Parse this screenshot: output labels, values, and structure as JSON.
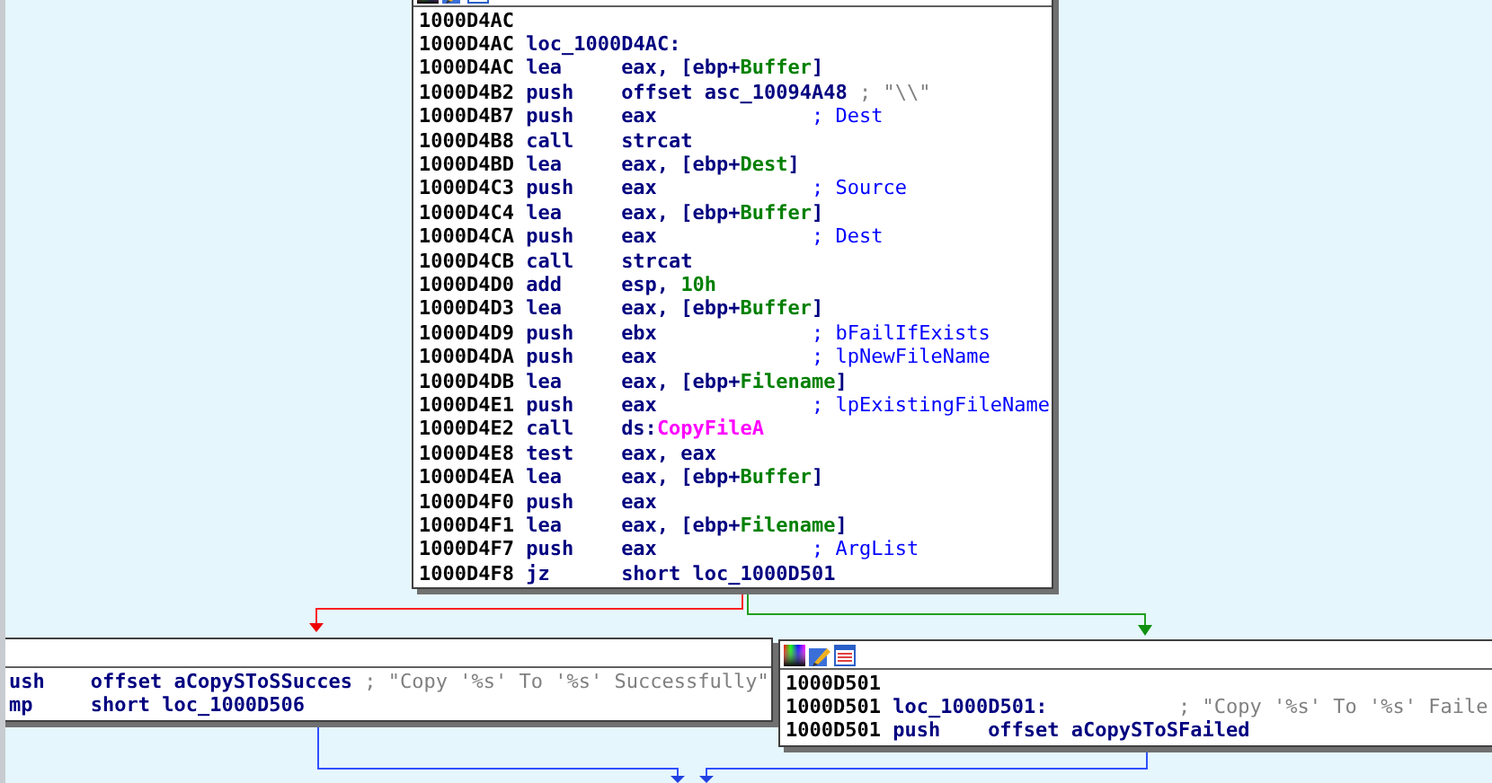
{
  "nodes": [
    {
      "icons": true,
      "lines": [
        {
          "address": "1000D4AC"
        },
        {
          "address": "1000D4AC",
          "label": "loc_1000D4AC:"
        },
        {
          "address": "1000D4AC",
          "mnemonic": "lea",
          "operand": [
            {
              "text": "eax, [ebp+",
              "kind": "plain"
            },
            {
              "text": "Buffer",
              "kind": "var"
            },
            {
              "text": "]",
              "kind": "plain"
            }
          ]
        },
        {
          "address": "1000D4B2",
          "mnemonic": "push",
          "operand": [
            {
              "text": "offset asc_10094A48",
              "kind": "plain"
            }
          ],
          "comment": {
            "text": "; \"\\\\\"",
            "kind": "string"
          }
        },
        {
          "address": "1000D4B7",
          "mnemonic": "push",
          "operand": [
            {
              "text": "eax",
              "kind": "plain"
            }
          ],
          "comment": {
            "text": "; Dest",
            "kind": "note"
          }
        },
        {
          "address": "1000D4B8",
          "mnemonic": "call",
          "operand": [
            {
              "text": "strcat",
              "kind": "plain"
            }
          ]
        },
        {
          "address": "1000D4BD",
          "mnemonic": "lea",
          "operand": [
            {
              "text": "eax, [ebp+",
              "kind": "plain"
            },
            {
              "text": "Dest",
              "kind": "var"
            },
            {
              "text": "]",
              "kind": "plain"
            }
          ]
        },
        {
          "address": "1000D4C3",
          "mnemonic": "push",
          "operand": [
            {
              "text": "eax",
              "kind": "plain"
            }
          ],
          "comment": {
            "text": "; Source",
            "kind": "note"
          }
        },
        {
          "address": "1000D4C4",
          "mnemonic": "lea",
          "operand": [
            {
              "text": "eax, [ebp+",
              "kind": "plain"
            },
            {
              "text": "Buffer",
              "kind": "var"
            },
            {
              "text": "]",
              "kind": "plain"
            }
          ]
        },
        {
          "address": "1000D4CA",
          "mnemonic": "push",
          "operand": [
            {
              "text": "eax",
              "kind": "plain"
            }
          ],
          "comment": {
            "text": "; Dest",
            "kind": "note"
          }
        },
        {
          "address": "1000D4CB",
          "mnemonic": "call",
          "operand": [
            {
              "text": "strcat",
              "kind": "plain"
            }
          ]
        },
        {
          "address": "1000D4D0",
          "mnemonic": "add",
          "operand": [
            {
              "text": "esp, ",
              "kind": "plain"
            },
            {
              "text": "10h",
              "kind": "number"
            }
          ]
        },
        {
          "address": "1000D4D3",
          "mnemonic": "lea",
          "operand": [
            {
              "text": "eax, [ebp+",
              "kind": "plain"
            },
            {
              "text": "Buffer",
              "kind": "var"
            },
            {
              "text": "]",
              "kind": "plain"
            }
          ]
        },
        {
          "address": "1000D4D9",
          "mnemonic": "push",
          "operand": [
            {
              "text": "ebx",
              "kind": "plain"
            }
          ],
          "comment": {
            "text": "; bFailIfExists",
            "kind": "note"
          }
        },
        {
          "address": "1000D4DA",
          "mnemonic": "push",
          "operand": [
            {
              "text": "eax",
              "kind": "plain"
            }
          ],
          "comment": {
            "text": "; lpNewFileName",
            "kind": "note"
          }
        },
        {
          "address": "1000D4DB",
          "mnemonic": "lea",
          "operand": [
            {
              "text": "eax, [ebp+",
              "kind": "plain"
            },
            {
              "text": "Filename",
              "kind": "var"
            },
            {
              "text": "]",
              "kind": "plain"
            }
          ]
        },
        {
          "address": "1000D4E1",
          "mnemonic": "push",
          "operand": [
            {
              "text": "eax",
              "kind": "plain"
            }
          ],
          "comment": {
            "text": "; lpExistingFileName",
            "kind": "note"
          }
        },
        {
          "address": "1000D4E2",
          "mnemonic": "call",
          "operand": [
            {
              "text": "ds:",
              "kind": "plain"
            },
            {
              "text": "CopyFileA",
              "kind": "import"
            }
          ]
        },
        {
          "address": "1000D4E8",
          "mnemonic": "test",
          "operand": [
            {
              "text": "eax, eax",
              "kind": "plain"
            }
          ]
        },
        {
          "address": "1000D4EA",
          "mnemonic": "lea",
          "operand": [
            {
              "text": "eax, [ebp+",
              "kind": "plain"
            },
            {
              "text": "Buffer",
              "kind": "var"
            },
            {
              "text": "]",
              "kind": "plain"
            }
          ]
        },
        {
          "address": "1000D4F0",
          "mnemonic": "push",
          "operand": [
            {
              "text": "eax",
              "kind": "plain"
            }
          ]
        },
        {
          "address": "1000D4F1",
          "mnemonic": "lea",
          "operand": [
            {
              "text": "eax, [ebp+",
              "kind": "plain"
            },
            {
              "text": "Filename",
              "kind": "var"
            },
            {
              "text": "]",
              "kind": "plain"
            }
          ]
        },
        {
          "address": "1000D4F7",
          "mnemonic": "push",
          "operand": [
            {
              "text": "eax",
              "kind": "plain"
            }
          ],
          "comment": {
            "text": "; ArgList",
            "kind": "note"
          }
        },
        {
          "address": "1000D4F8",
          "mnemonic": "jz",
          "operand": [
            {
              "text": "short loc_1000D501",
              "kind": "plain"
            }
          ]
        }
      ]
    },
    {
      "icons": false,
      "lines": [
        {
          "mnemonic": "ush",
          "operand": [
            {
              "text": "offset aCopySToSSucces",
              "kind": "plain"
            }
          ],
          "comment": {
            "text": "; \"Copy '%s' To '%s' Successfully\"",
            "kind": "string"
          }
        },
        {
          "mnemonic": "mp",
          "operand": [
            {
              "text": "short loc_1000D506",
              "kind": "plain"
            }
          ]
        }
      ]
    },
    {
      "icons": true,
      "lines": [
        {
          "address": "1000D501"
        },
        {
          "address": "1000D501",
          "label": "loc_1000D501:",
          "comment": {
            "text": "; \"Copy '%s' To '%s' Faile",
            "kind": "string"
          }
        },
        {
          "address": "1000D501",
          "mnemonic": "push",
          "operand": [
            {
              "text": "offset aCopySToSFailed",
              "kind": "plain"
            }
          ]
        }
      ]
    }
  ]
}
